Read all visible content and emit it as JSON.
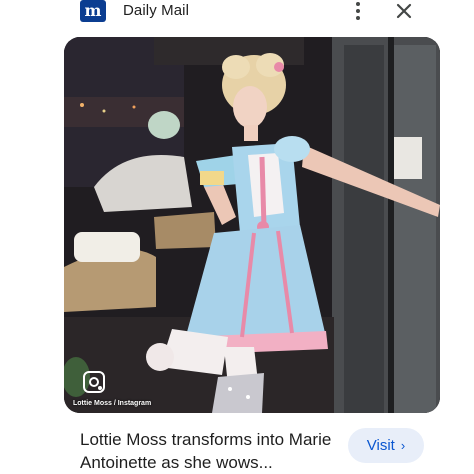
{
  "source": {
    "name": "Daily Mail",
    "favicon_letter": "m",
    "favicon_color": "#0b3d91"
  },
  "header": {
    "more_icon": "more-vert-icon",
    "close_icon": "close-icon"
  },
  "image": {
    "credit": "Lottie Moss / Instagram",
    "lens_icon": "lens-icon"
  },
  "result": {
    "title": "Lottie Moss transforms into Marie Antoinette as she wows...",
    "visit_label": "Visit",
    "visit_chevron": "›"
  },
  "colors": {
    "accent": "#0b57d0",
    "visit_bg": "#e8eef9"
  }
}
